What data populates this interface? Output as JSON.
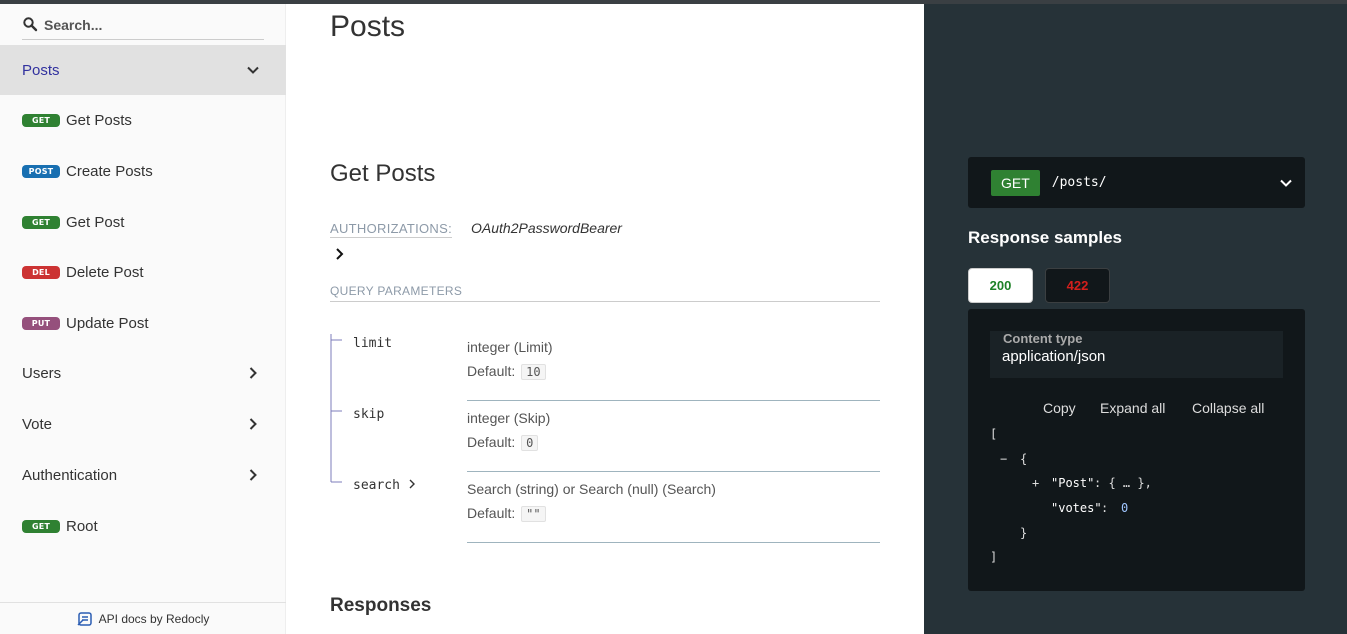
{
  "colors": {
    "accent": "#32329f",
    "get": "#2f8132",
    "post": "#186fb1",
    "delete": "#cc3333",
    "put": "#95507c",
    "right_panel_bg": "#263238",
    "code_bg": "#11171a"
  },
  "sidebar": {
    "search": {
      "placeholder": "Search..."
    },
    "items": [
      {
        "label": "Posts",
        "type": "group",
        "expanded": true,
        "active": true
      },
      {
        "label": "Get Posts",
        "badge": "GET"
      },
      {
        "label": "Create Posts",
        "badge": "POST"
      },
      {
        "label": "Get Post",
        "badge": "GET"
      },
      {
        "label": "Delete Post",
        "badge": "DEL"
      },
      {
        "label": "Update Post",
        "badge": "PUT"
      },
      {
        "label": "Users",
        "type": "group",
        "expanded": false
      },
      {
        "label": "Vote",
        "type": "group",
        "expanded": false
      },
      {
        "label": "Authentication",
        "type": "group",
        "expanded": false
      },
      {
        "label": "Root",
        "badge": "GET"
      }
    ],
    "footer": "API docs by Redocly"
  },
  "main": {
    "section_title": "Posts",
    "operation_title": "Get Posts",
    "authorizations_label": "AUTHORIZATIONS:",
    "authorizations_value": "OAuth2PasswordBearer",
    "query_params_label": "QUERY PARAMETERS",
    "default_label": "Default:",
    "params": [
      {
        "name": "limit",
        "type": "integer (Limit)",
        "default": "10"
      },
      {
        "name": "skip",
        "type": "integer (Skip)",
        "default": "0"
      },
      {
        "name": "search",
        "type": "Search (string) or Search (null) (Search)",
        "default": "\"\""
      }
    ],
    "responses_title": "Responses"
  },
  "right": {
    "method": "GET",
    "path": "/posts/",
    "samples_title": "Response samples",
    "tabs": [
      "200",
      "422"
    ],
    "content_type_label": "Content type",
    "content_type_value": "application/json",
    "actions": [
      "Copy",
      "Expand all",
      "Collapse all"
    ],
    "code": {
      "open_bracket": "[",
      "collapse_marker": "−",
      "open_brace": "{",
      "expand_marker": "+",
      "key_post": "\"Post\"",
      "post_value": ": { … },",
      "key_votes": "\"votes\"",
      "colon": ": ",
      "votes_value": "0",
      "close_brace": "}",
      "close_bracket": "]"
    }
  }
}
